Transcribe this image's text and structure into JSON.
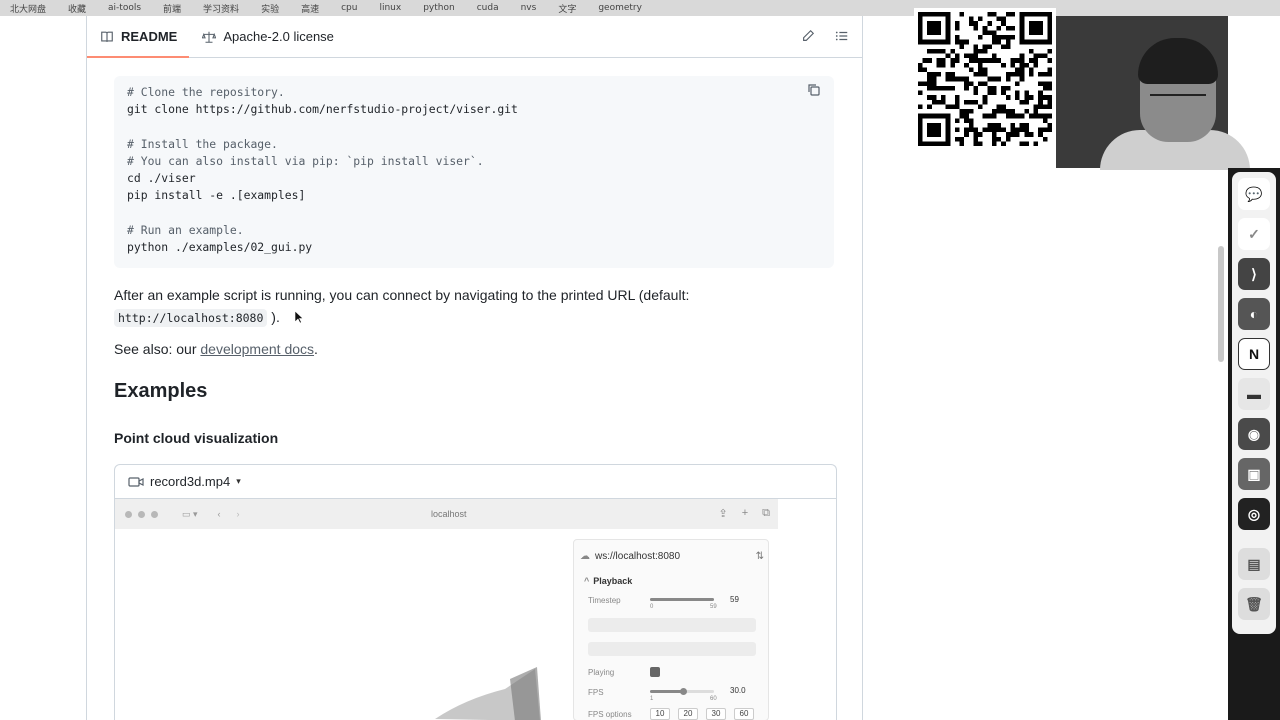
{
  "bookmarks": [
    "北大网盘",
    "收藏",
    "ai-tools",
    "前端",
    "学习资料",
    "实验",
    "高速",
    "cpu",
    "linux",
    "python",
    "cuda",
    "nvs",
    "文字",
    "geometry"
  ],
  "readme_tabs": {
    "readme": "README",
    "license": "Apache-2.0 license"
  },
  "code_block": {
    "lines": [
      {
        "text": "# Clone the repository.",
        "comment": true
      },
      {
        "text": "git clone https://github.com/nerfstudio-project/viser.git",
        "comment": false
      },
      {
        "text": "",
        "comment": false
      },
      {
        "text": "# Install the package.",
        "comment": true
      },
      {
        "text": "# You can also install via pip: `pip install viser`.",
        "comment": true
      },
      {
        "text": "cd ./viser",
        "comment": false
      },
      {
        "text": "pip install -e .[examples]",
        "comment": false
      },
      {
        "text": "",
        "comment": false
      },
      {
        "text": "# Run an example.",
        "comment": true
      },
      {
        "text": "python ./examples/02_gui.py",
        "comment": false
      }
    ]
  },
  "paragraph_running": {
    "text_before": "After an example script is running, you can connect by navigating to the printed URL (default:",
    "code": "http://localhost:8080",
    "text_after": ")."
  },
  "paragraph_see_also": {
    "prefix": "See also: our ",
    "link": "development docs",
    "suffix": "."
  },
  "examples_heading": "Examples",
  "point_cloud_heading": "Point cloud visualization",
  "video": {
    "filename": "record3d.mp4",
    "browser_url": "localhost",
    "viser_ws": "ws://localhost:8080",
    "playback_label": "Playback",
    "timestep_label": "Timestep",
    "timestep_min": "0",
    "timestep_max": "59",
    "timestep_value": "59",
    "playing_label": "Playing",
    "fps_label": "FPS",
    "fps_min": "1",
    "fps_max": "60",
    "fps_value": "30.0",
    "fps_options_label": "FPS options",
    "fps_options": [
      "10",
      "20",
      "30",
      "60"
    ]
  },
  "icons": {
    "readme": "book-icon",
    "license": "scale-icon",
    "edit": "pencil-icon",
    "toc": "list-icon",
    "copy": "copy-icon",
    "video": "video-icon"
  }
}
